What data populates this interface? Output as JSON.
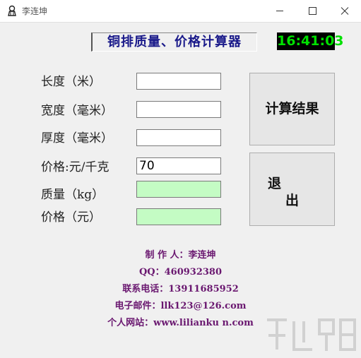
{
  "window": {
    "title": "李连坤",
    "icon": "person-icon",
    "controls": {
      "minimize": "minimize-icon",
      "maximize": "maximize-icon",
      "close": "close-icon"
    }
  },
  "header": {
    "title": "铜排质量、价格计算器",
    "clock": "16:41:03"
  },
  "form": {
    "fields": [
      {
        "label": "长度（米）",
        "value": ""
      },
      {
        "label": "宽度（毫米）",
        "value": ""
      },
      {
        "label": "厚度（毫米）",
        "value": ""
      },
      {
        "label": "价格:元/千克",
        "value": "70"
      },
      {
        "label": "质量（kg）",
        "value": ""
      },
      {
        "label": "价格（元）",
        "value": ""
      }
    ]
  },
  "buttons": {
    "calculate": "计算结果",
    "exit_line1": "退",
    "exit_line2": "出"
  },
  "credits": {
    "author": "制 作 人：李连坤",
    "qq": "QQ：460932380",
    "phone": "联系电话：13911685952",
    "email": "电子邮件：llk123@126.com",
    "website": "个人网站：www.lilianku n.com"
  },
  "colors": {
    "header_text": "#1a1a8a",
    "clock_bg": "#000000",
    "clock_text": "#00e000",
    "output_bg": "#c4fcc4",
    "credits_text": "#6a1870"
  }
}
